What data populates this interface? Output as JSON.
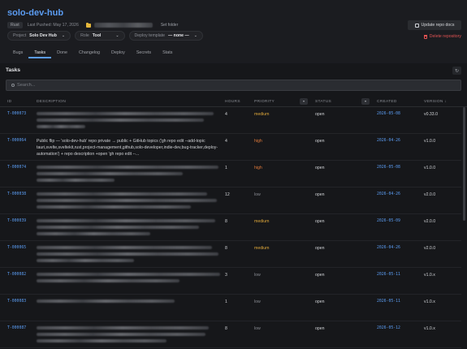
{
  "header": {
    "title": "solo-dev-hub",
    "language_badge": "Rust",
    "last_pushed": "Last Pushed: May 17, 2026",
    "set_folder_label": "Set folder",
    "update_docs_label": "Update repo docs",
    "delete_label": "Delete repository",
    "project": {
      "label": "Project",
      "value": "Solo Dev Hub"
    },
    "role": {
      "label": "Role",
      "value": "Tool"
    },
    "deploy_template": {
      "label": "Deploy template",
      "value": "— none —"
    }
  },
  "tabs": [
    "Bugs",
    "Tasks",
    "Done",
    "Changelog",
    "Deploy",
    "Secrets",
    "Stats"
  ],
  "active_tab": "Tasks",
  "section_title": "Tasks",
  "search": {
    "placeholder": "Search..."
  },
  "columns": {
    "id": "ID",
    "description": "DESCRIPTION",
    "hours": "HOURS",
    "priority": "PRIORITY",
    "status": "STATUS",
    "created": "CREATED",
    "version": "VERSION ↓"
  },
  "colors": {
    "accent": "#5b9cf2",
    "medium": "#e0a93a",
    "high": "#e07a3a",
    "danger": "#e05252"
  },
  "tasks": [
    {
      "id": "T-000073",
      "desc": "",
      "hours": "4",
      "priority": "medium",
      "status": "open",
      "created": "2026-05-08",
      "version": "v0.33.0"
    },
    {
      "id": "T-000064",
      "desc": "Public flip — 'solo-dev-hub' repo private → public + GitHub topics ('gh repo edit --add-topic tauri,svelte,sveltekit,rust,project-management,github,solo-developer,indie-dev,bug-tracker,deploy-automation') + repo description +open 'gh repo edit --...",
      "hours": "4",
      "priority": "high",
      "status": "open",
      "created": "2026-04-26",
      "version": "v1.0.0"
    },
    {
      "id": "T-000074",
      "desc": "",
      "hours": "1",
      "priority": "high",
      "status": "open",
      "created": "2026-05-08",
      "version": "v1.0.0"
    },
    {
      "id": "T-000038",
      "desc": "",
      "hours": "12",
      "priority": "low",
      "status": "open",
      "created": "2026-04-26",
      "version": "v2.0.0"
    },
    {
      "id": "T-000039",
      "desc": "",
      "hours": "8",
      "priority": "medium",
      "status": "open",
      "created": "2026-05-09",
      "version": "v2.0.0"
    },
    {
      "id": "T-000065",
      "desc": "",
      "hours": "8",
      "priority": "medium",
      "status": "open",
      "created": "2026-04-26",
      "version": "v2.0.0"
    },
    {
      "id": "T-000082",
      "desc": "",
      "hours": "3",
      "priority": "low",
      "status": "open",
      "created": "2026-05-11",
      "version": "v1.0.x"
    },
    {
      "id": "T-000083",
      "desc": "",
      "hours": "1",
      "priority": "low",
      "status": "open",
      "created": "2026-05-11",
      "version": "v1.0.x"
    },
    {
      "id": "T-000087",
      "desc": "",
      "hours": "8",
      "priority": "low",
      "status": "open",
      "created": "2026-05-12",
      "version": "v1.0.x"
    }
  ]
}
